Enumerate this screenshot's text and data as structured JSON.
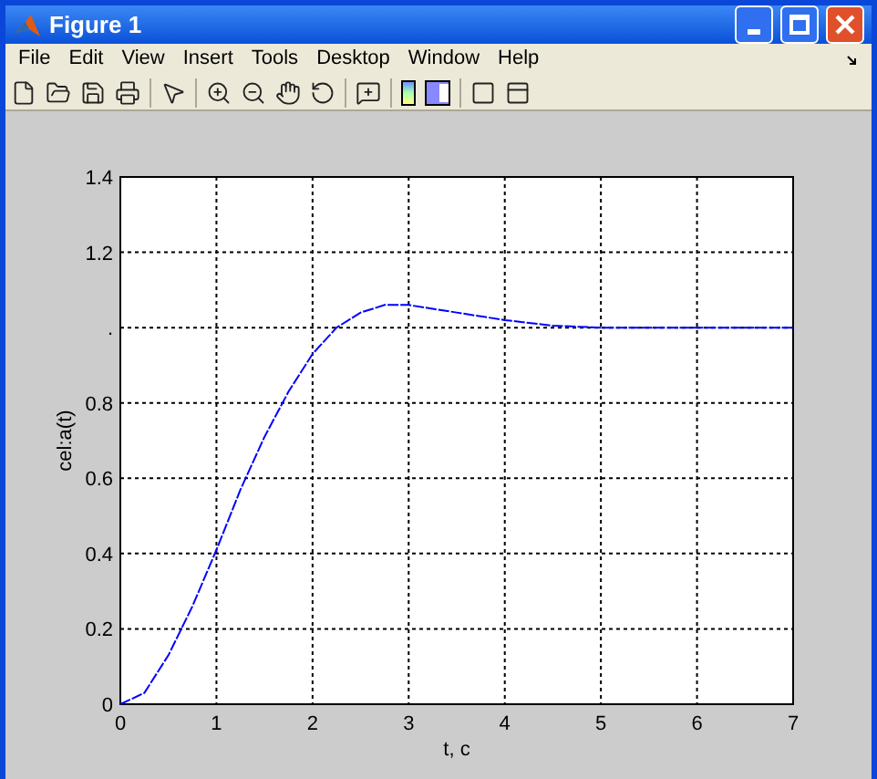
{
  "window": {
    "title": "Figure 1"
  },
  "menu": [
    "File",
    "Edit",
    "View",
    "Insert",
    "Tools",
    "Desktop",
    "Window",
    "Help"
  ],
  "figure": {
    "chart_data": {
      "type": "line",
      "xlabel": "t, c",
      "ylabel": "cel:a(t)",
      "x": [
        0,
        0.25,
        0.5,
        0.75,
        1,
        1.25,
        1.5,
        1.75,
        2,
        2.25,
        2.5,
        2.75,
        3,
        3.25,
        3.5,
        3.75,
        4,
        4.5,
        5,
        5.5,
        6,
        6.5,
        7
      ],
      "grid": true,
      "series": [
        {
          "color": "#0000ff",
          "line_style": "dashed",
          "values": [
            0,
            0.03,
            0.13,
            0.26,
            0.41,
            0.57,
            0.71,
            0.83,
            0.93,
            1.0,
            1.04,
            1.06,
            1.06,
            1.05,
            1.04,
            1.03,
            1.02,
            1.005,
            1.0,
            1.0,
            1.0,
            1.0,
            1.0
          ]
        }
      ],
      "xlim": [
        0,
        7
      ],
      "ylim": [
        0,
        1.4
      ],
      "xticks": [
        0,
        1,
        2,
        3,
        4,
        5,
        6,
        7
      ],
      "yticks": [
        0,
        0.2,
        0.4,
        0.6,
        0.8,
        {
          "value": 1,
          "label": "."
        },
        1.2,
        1.4
      ]
    }
  }
}
